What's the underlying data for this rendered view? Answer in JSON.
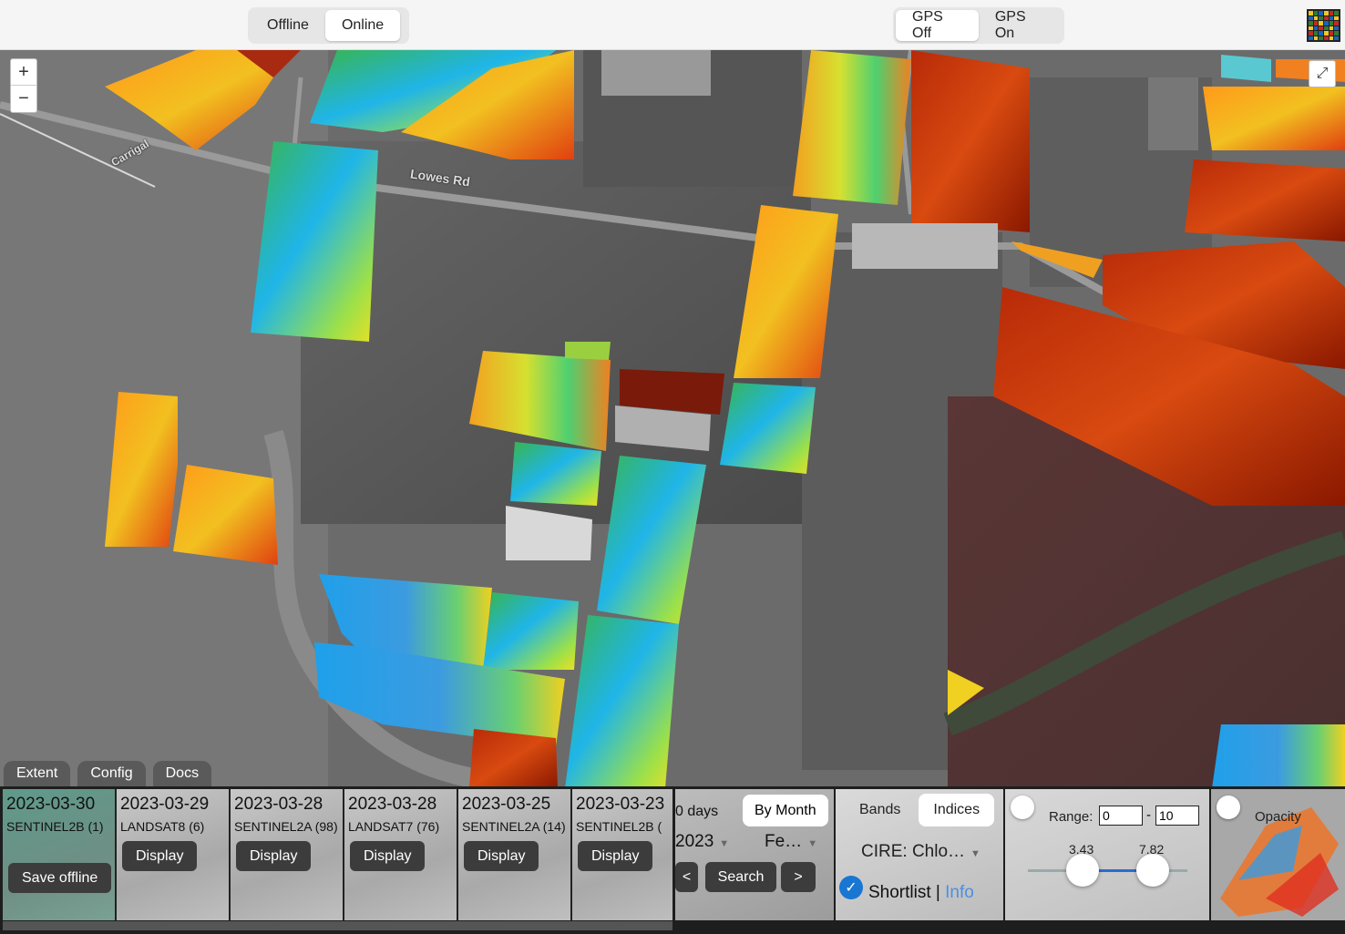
{
  "topbar": {
    "mode": {
      "offline": "Offline",
      "online": "Online",
      "selected": "Online"
    },
    "gps": {
      "off": "GPS Off",
      "on": "GPS On",
      "selected": "GPS Off"
    },
    "app_icon": "grid-logo-icon"
  },
  "map": {
    "zoom_in": "+",
    "zoom_out": "−",
    "fullscreen": "⤢",
    "road_labels": [
      "Lowes Rd",
      "Carrigal"
    ],
    "tabs": [
      "Extent",
      "Config",
      "Docs"
    ]
  },
  "scenes": [
    {
      "date": "2023-03-30",
      "satellite": "SENTINEL2B (1)",
      "action": "Save offline",
      "selected": true
    },
    {
      "date": "2023-03-29",
      "satellite": "LANDSAT8 (6)",
      "action": "Display",
      "selected": false
    },
    {
      "date": "2023-03-28",
      "satellite": "SENTINEL2A (98)",
      "action": "Display",
      "selected": false
    },
    {
      "date": "2023-03-28",
      "satellite": "LANDSAT7 (76)",
      "action": "Display",
      "selected": false
    },
    {
      "date": "2023-03-25",
      "satellite": "SENTINEL2A (14)",
      "action": "Display",
      "selected": false
    },
    {
      "date": "2023-03-23",
      "satellite": "SENTINEL2B (",
      "action": "Display",
      "selected": false
    }
  ],
  "filter": {
    "days": "0 days",
    "by_month": "By Month",
    "year": "2023",
    "month": "Fe…",
    "prev": "<",
    "search": "Search",
    "next": ">"
  },
  "indices": {
    "bands": "Bands",
    "indices": "Indices",
    "selected_tab": "Indices",
    "selected_index": "CIRE: Chlo…",
    "shortlist": "Shortlist",
    "separator": "|",
    "info": "Info",
    "shortlist_checked": true
  },
  "range": {
    "label": "Range:",
    "min": "0",
    "dash": "-",
    "max": "10",
    "low_value": "3.43",
    "high_value": "7.82"
  },
  "opacity": {
    "label": "Opacity"
  }
}
